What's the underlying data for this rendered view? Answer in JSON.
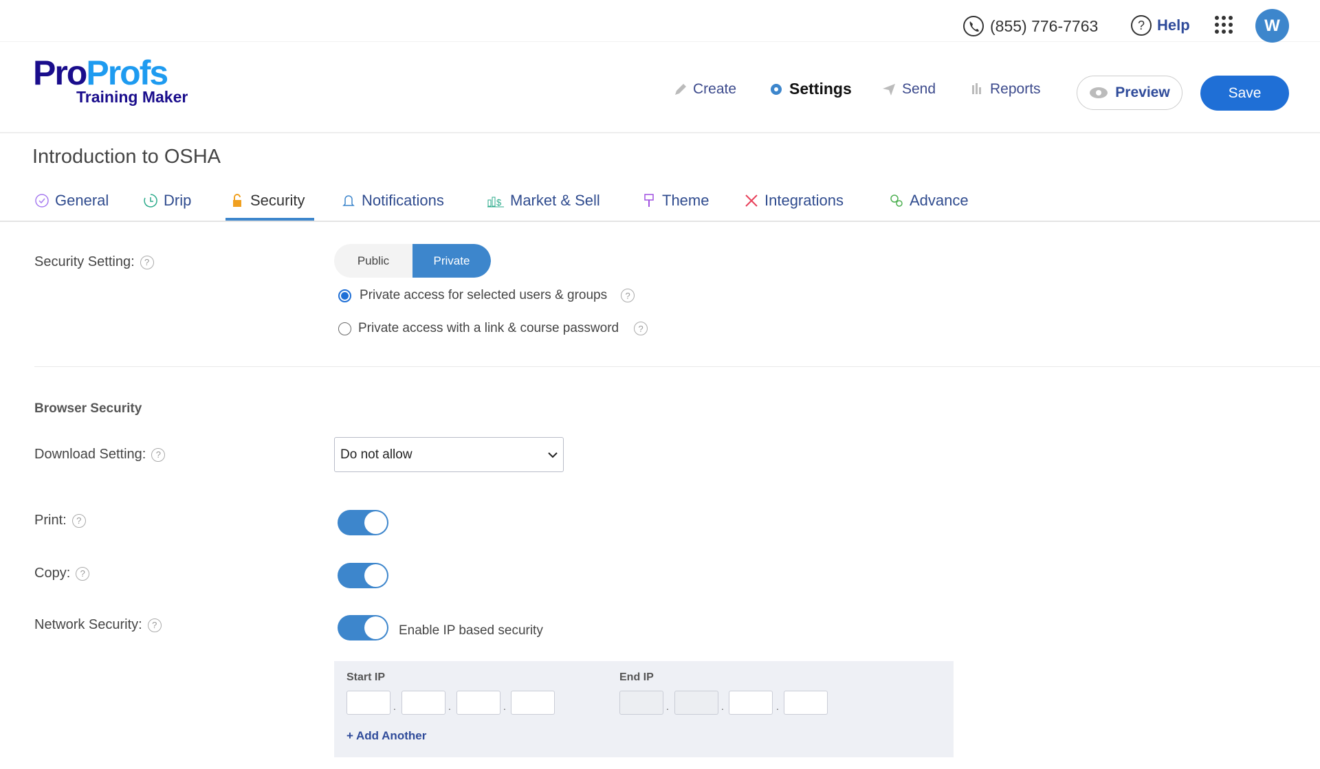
{
  "topbar": {
    "phone": "(855) 776-7763",
    "help": "Help",
    "avatar": "W",
    "icons": [
      "phone-icon",
      "help-icon",
      "apps-grid-icon"
    ]
  },
  "logo": {
    "brand": "ProProfs",
    "product": "Training Maker"
  },
  "nav": {
    "create": "Create",
    "settings": "Settings",
    "send": "Send",
    "reports": "Reports",
    "preview": "Preview",
    "save": "Save"
  },
  "title": "Introduction to OSHA",
  "tabs": [
    {
      "label": "General"
    },
    {
      "label": "Drip"
    },
    {
      "label": "Security",
      "active": true
    },
    {
      "label": "Notifications"
    },
    {
      "label": "Market & Sell"
    },
    {
      "label": "Theme"
    },
    {
      "label": "Integrations"
    },
    {
      "label": "Advance"
    }
  ],
  "security": {
    "label": "Security Setting:",
    "options": [
      "Public",
      "Private"
    ],
    "selected": "Private",
    "radios": [
      {
        "label": "Private access for selected users & groups",
        "checked": true
      },
      {
        "label": "Private access with a link & course password",
        "checked": false
      }
    ]
  },
  "browser": {
    "heading": "Browser Security",
    "download_label": "Download Setting:",
    "download_value": "Do not allow",
    "print_label": "Print:",
    "print_on": true,
    "copy_label": "Copy:",
    "copy_on": true,
    "network_label": "Network Security:",
    "network_on": true,
    "network_text": "Enable IP based security",
    "start_ip": "Start IP",
    "end_ip": "End IP",
    "add_another": "+ Add Another"
  },
  "colors": {
    "accent": "#1f6fd6",
    "toggle": "#3d86cc",
    "brand_dark": "#1a0d8c",
    "brand_light": "#1e9bf0"
  }
}
